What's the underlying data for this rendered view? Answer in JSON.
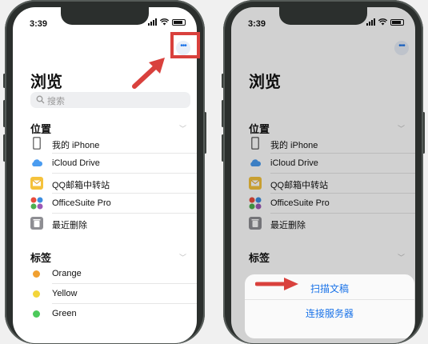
{
  "status_time": "3:39",
  "title": "浏览",
  "search_placeholder": "搜索",
  "locations_header": "位置",
  "locations": [
    {
      "label": "我的 iPhone",
      "icon": "phone-icon"
    },
    {
      "label": "iCloud Drive",
      "icon": "cloud-icon"
    },
    {
      "label": "QQ邮箱中转站",
      "icon": "mail-icon"
    },
    {
      "label": "OfficeSuite Pro",
      "icon": "officesuite-icon"
    },
    {
      "label": "最近删除",
      "icon": "trash-icon"
    }
  ],
  "tags_header": "标签",
  "tags": [
    {
      "label": "Orange",
      "color": "#f0a030"
    },
    {
      "label": "Yellow",
      "color": "#f3d53a"
    },
    {
      "label": "Green",
      "color": "#4cc95b"
    }
  ],
  "more_label": "•••",
  "sheet_items": [
    "扫描文稿",
    "连接服务器"
  ],
  "accent_color": "#1a73e8",
  "annotation_color": "#d9413d"
}
